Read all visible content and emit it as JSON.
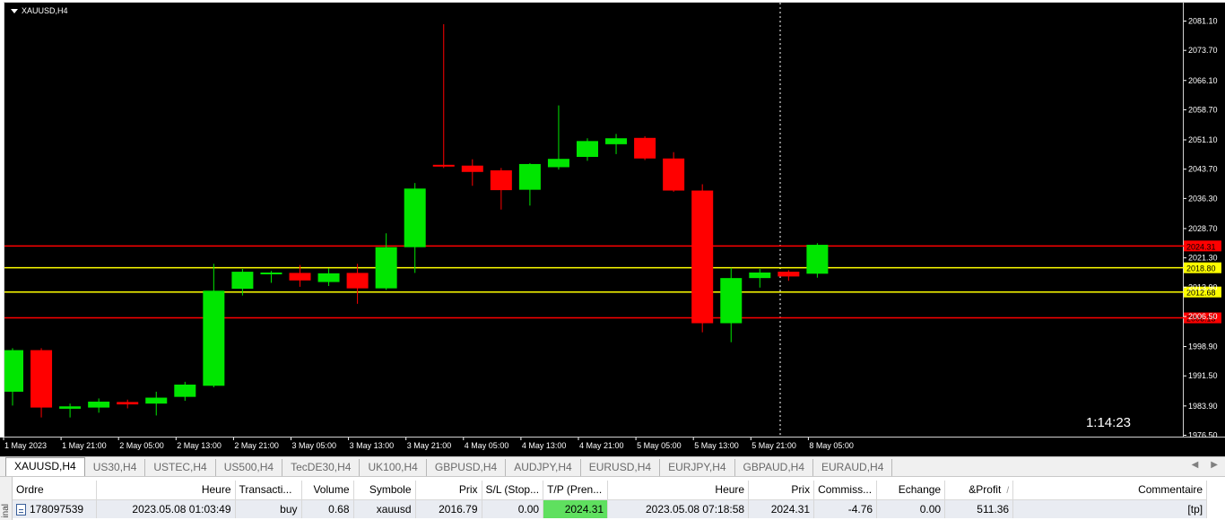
{
  "chart": {
    "symbol_label": "XAUUSD,H4",
    "countdown": "1:14:23",
    "colors": {
      "bull": "#00e600",
      "bear": "#ff0000",
      "background": "#000000",
      "level_red": "#ff0000",
      "level_yellow": "#ffff00"
    }
  },
  "chart_data": {
    "type": "candlestick",
    "ylim": [
      1976.5,
      2084.0
    ],
    "y_ticks": [
      "2081.10",
      "2073.70",
      "2066.10",
      "2058.70",
      "2051.10",
      "2043.70",
      "2036.30",
      "2028.70",
      "2021.30",
      "2013.90",
      "2006.50",
      "1998.90",
      "1991.50",
      "1983.90",
      "1976.50"
    ],
    "x_ticks": [
      "1 May 2023",
      "1 May 21:00",
      "2 May 05:00",
      "2 May 13:00",
      "2 May 21:00",
      "3 May 05:00",
      "3 May 13:00",
      "3 May 21:00",
      "4 May 05:00",
      "4 May 13:00",
      "4 May 21:00",
      "5 May 05:00",
      "5 May 13:00",
      "5 May 21:00",
      "8 May 05:00"
    ],
    "candles": [
      {
        "o": 1987.5,
        "h": 1998.5,
        "l": 1984.0,
        "c": 1998.0
      },
      {
        "o": 1998.0,
        "h": 1998.5,
        "l": 1981.0,
        "c": 1983.5
      },
      {
        "o": 1983.2,
        "h": 1984.5,
        "l": 1981.0,
        "c": 1983.8
      },
      {
        "o": 1983.5,
        "h": 1985.8,
        "l": 1982.2,
        "c": 1985.0
      },
      {
        "o": 1984.9,
        "h": 1985.5,
        "l": 1983.3,
        "c": 1984.3
      },
      {
        "o": 1984.5,
        "h": 1987.5,
        "l": 1981.5,
        "c": 1986.0
      },
      {
        "o": 1986.2,
        "h": 1990.0,
        "l": 1985.2,
        "c": 1989.3
      },
      {
        "o": 1989.0,
        "h": 2019.8,
        "l": 1988.6,
        "c": 2013.0
      },
      {
        "o": 2013.5,
        "h": 2018.5,
        "l": 2011.8,
        "c": 2017.8
      },
      {
        "o": 2017.2,
        "h": 2018.0,
        "l": 2015.0,
        "c": 2017.6
      },
      {
        "o": 2017.5,
        "h": 2019.5,
        "l": 2014.0,
        "c": 2015.6
      },
      {
        "o": 2015.2,
        "h": 2018.6,
        "l": 2014.2,
        "c": 2017.4
      },
      {
        "o": 2017.5,
        "h": 2019.8,
        "l": 2009.7,
        "c": 2013.6
      },
      {
        "o": 2013.6,
        "h": 2027.5,
        "l": 2013.2,
        "c": 2024.0
      },
      {
        "o": 2024.0,
        "h": 2040.2,
        "l": 2017.5,
        "c": 2038.8
      },
      {
        "o": 2044.8,
        "h": 2080.3,
        "l": 2044.0,
        "c": 2044.5
      },
      {
        "o": 2044.6,
        "h": 2046.2,
        "l": 2039.5,
        "c": 2043.0
      },
      {
        "o": 2043.4,
        "h": 2044.0,
        "l": 2033.5,
        "c": 2038.4
      },
      {
        "o": 2038.5,
        "h": 2045.2,
        "l": 2034.5,
        "c": 2045.0
      },
      {
        "o": 2044.2,
        "h": 2059.8,
        "l": 2043.6,
        "c": 2046.3
      },
      {
        "o": 2046.8,
        "h": 2051.5,
        "l": 2045.8,
        "c": 2050.8
      },
      {
        "o": 2050.0,
        "h": 2052.6,
        "l": 2047.5,
        "c": 2051.5
      },
      {
        "o": 2051.6,
        "h": 2052.0,
        "l": 2046.0,
        "c": 2046.4
      },
      {
        "o": 2046.4,
        "h": 2048.0,
        "l": 2038.0,
        "c": 2038.3
      },
      {
        "o": 2038.3,
        "h": 2039.9,
        "l": 2002.5,
        "c": 2004.8
      },
      {
        "o": 2004.8,
        "h": 2018.8,
        "l": 2000.0,
        "c": 2016.2
      },
      {
        "o": 2016.2,
        "h": 2018.5,
        "l": 2013.8,
        "c": 2017.6
      },
      {
        "o": 2017.8,
        "h": 2018.2,
        "l": 2015.5,
        "c": 2016.6
      },
      {
        "o": 2017.3,
        "h": 2025.0,
        "l": 2016.3,
        "c": 2024.6
      }
    ],
    "levels": [
      {
        "price": 2024.31,
        "label": "2024.31",
        "color": "#ff0000"
      },
      {
        "price": 2018.8,
        "label": "2018.80",
        "color": "#ffff00"
      },
      {
        "price": 2012.68,
        "label": "2012.68",
        "color": "#ffff00"
      },
      {
        "price": 2006.15,
        "label": "2006.15",
        "color": "#ff0000"
      }
    ]
  },
  "tabs": [
    "XAUUSD,H4",
    "US30,H4",
    "USTEC,H4",
    "US500,H4",
    "TecDE30,H4",
    "UK100,H4",
    "GBPUSD,H4",
    "AUDJPY,H4",
    "EURUSD,H4",
    "EURJPY,H4",
    "GBPAUD,H4",
    "EURAUD,H4"
  ],
  "terminal": {
    "side_label": "inal",
    "columns": [
      "Ordre",
      "Heure",
      "Transacti...",
      "Volume",
      "Symbole",
      "Prix",
      "S/L (Stop...",
      "T/P (Pren...",
      "Heure",
      "Prix",
      "Commiss...",
      "Echange",
      "&Profit",
      "Commentaire"
    ],
    "row": {
      "ordre": "178097539",
      "heure_open": "2023.05.08 01:03:49",
      "type": "buy",
      "volume": "0.68",
      "symbole": "xauusd",
      "prix_open": "2016.79",
      "sl": "0.00",
      "tp": "2024.31",
      "heure_close": "2023.05.08 07:18:58",
      "prix_close": "2024.31",
      "commission": "-4.76",
      "echange": "0.00",
      "profit": "511.36",
      "commentaire": "[tp]"
    }
  }
}
